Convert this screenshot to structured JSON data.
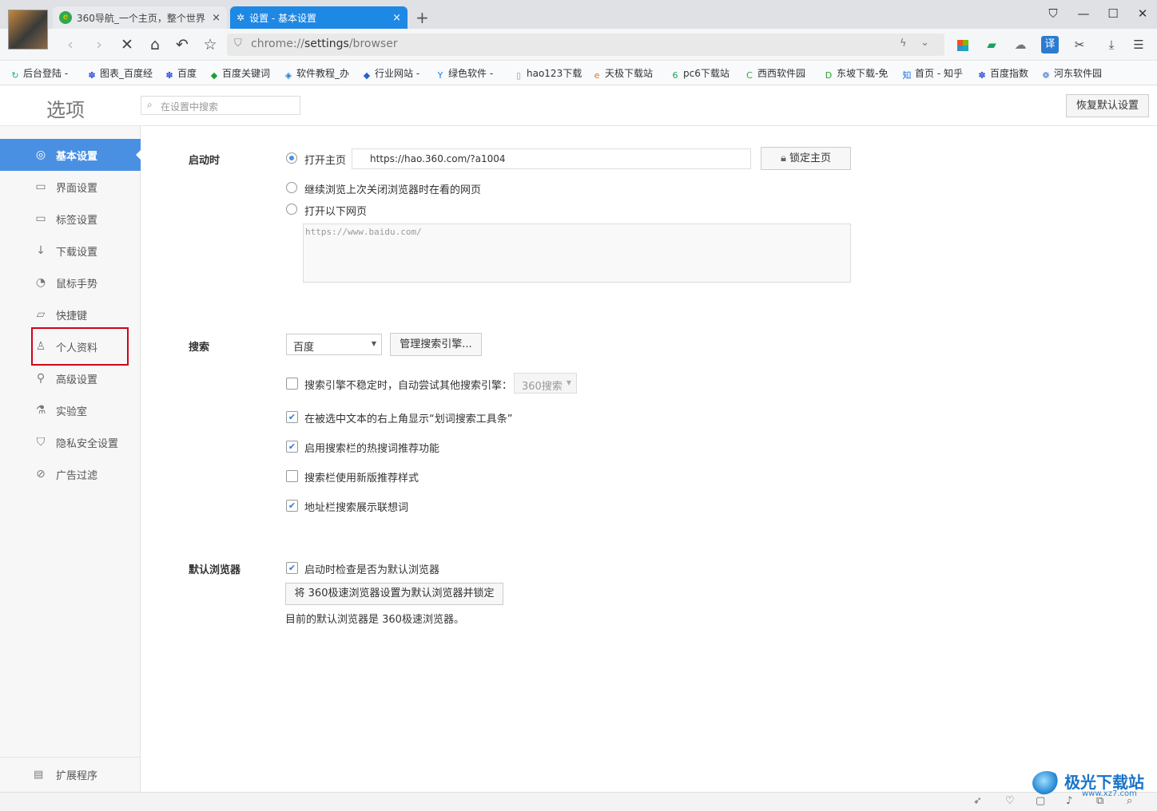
{
  "tabs": [
    {
      "title": "360导航_一个主页，整个世界",
      "close": "×"
    },
    {
      "title": "设置 - 基本设置",
      "close": "×"
    }
  ],
  "address": {
    "scheme": "chrome://",
    "host": "settings",
    "path": "/browser"
  },
  "bookmarks": [
    {
      "label": "后台登陆 -",
      "icon": "refresh-icon",
      "color": "#2a8"
    },
    {
      "label": "图表_百度经",
      "icon": "baidu-paw-icon",
      "color": "#2f4fd8"
    },
    {
      "label": "百度",
      "icon": "baidu-paw-icon",
      "color": "#2f4fd8"
    },
    {
      "label": "百度关键词",
      "icon": "bookmark-icon",
      "color": "#1a9e3a"
    },
    {
      "label": "软件教程_办",
      "icon": "software-icon",
      "color": "#2b7bd0"
    },
    {
      "label": "行业网站 -",
      "icon": "bookmark-icon",
      "color": "#2b5fd0"
    },
    {
      "label": "绿色软件 -",
      "icon": "green-y-icon",
      "color": "#1e7be0"
    },
    {
      "label": "hao123下载",
      "icon": "page-icon",
      "color": "#999999"
    },
    {
      "label": "天极下载站",
      "icon": "e-icon",
      "color": "#e8711c"
    },
    {
      "label": "pc6下载站",
      "icon": "pc6-icon",
      "color": "#1aa260"
    },
    {
      "label": "西西软件园",
      "icon": "cc-icon",
      "color": "#3aa13a"
    },
    {
      "label": "东坡下载-免",
      "icon": "dongpo-icon",
      "color": "#2f9e2f"
    },
    {
      "label": "首页 - 知乎",
      "icon": "zhihu-icon",
      "color": "#1e6fe0"
    },
    {
      "label": "百度指数",
      "icon": "baidu-paw-icon",
      "color": "#2f4fd8"
    },
    {
      "label": "河东软件园",
      "icon": "hedong-icon",
      "color": "#4a7bd0"
    }
  ],
  "header": {
    "title": "选项",
    "search_placeholder": "在设置中搜索",
    "restore": "恢复默认设置"
  },
  "sidebar": {
    "items": [
      {
        "label": "基本设置",
        "icon": "gear-icon"
      },
      {
        "label": "界面设置",
        "icon": "window-icon"
      },
      {
        "label": "标签设置",
        "icon": "tab-icon"
      },
      {
        "label": "下载设置",
        "icon": "download-icon"
      },
      {
        "label": "鼠标手势",
        "icon": "mouse-icon"
      },
      {
        "label": "快捷键",
        "icon": "keyboard-icon"
      },
      {
        "label": "个人资料",
        "icon": "user-icon"
      },
      {
        "label": "高级设置",
        "icon": "wrench-icon"
      },
      {
        "label": "实验室",
        "icon": "flask-icon"
      },
      {
        "label": "隐私安全设置",
        "icon": "shield-icon"
      },
      {
        "label": "广告过滤",
        "icon": "block-icon"
      }
    ],
    "extensions": "扩展程序"
  },
  "startup": {
    "label": "启动时",
    "opt_home": "打开主页",
    "home_url": "https://hao.360.com/?a1004",
    "lock_home": "锁定主页",
    "opt_continue": "继续浏览上次关闭浏览器时在看的网页",
    "opt_pages": "打开以下网页",
    "pages_text": "https://www.baidu.com/"
  },
  "search": {
    "label": "搜索",
    "engine": "百度",
    "manage": "管理搜索引擎...",
    "fallback": "搜索引擎不稳定时，自动尝试其他搜索引擎：",
    "fallback_engine": "360搜索",
    "opt1": "在被选中文本的右上角显示“划词搜索工具条”",
    "opt2": "启用搜索栏的热搜词推荐功能",
    "opt3": "搜索栏使用新版推荐样式",
    "opt4": "地址栏搜索展示联想词"
  },
  "default_browser": {
    "label": "默认浏览器",
    "check": "启动时检查是否为默认浏览器",
    "set_btn": "将 360极速浏览器设置为默认浏览器并锁定",
    "status": "目前的默认浏览器是 360极速浏览器。"
  },
  "watermark": "极光下载站",
  "watermark_url": "www.xz7.com"
}
